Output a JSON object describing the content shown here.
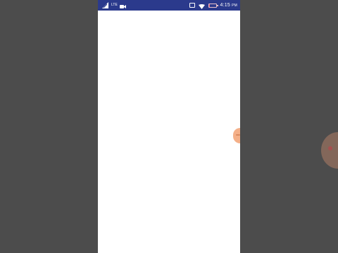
{
  "status_bar": {
    "network_label": "LTE",
    "time": "4:15",
    "time_suffix": "PM",
    "battery_level_fraction": 0.1,
    "icons": [
      "signal-icon",
      "lte-icon",
      "video-camera-icon",
      "cast-icon",
      "wifi-icon",
      "battery-icon"
    ]
  },
  "colors": {
    "status_bar": "#2b3a8c",
    "screen_background": "#ffffff",
    "outer_background": "#4c4c4c",
    "edge_handle": "#f4b089"
  }
}
